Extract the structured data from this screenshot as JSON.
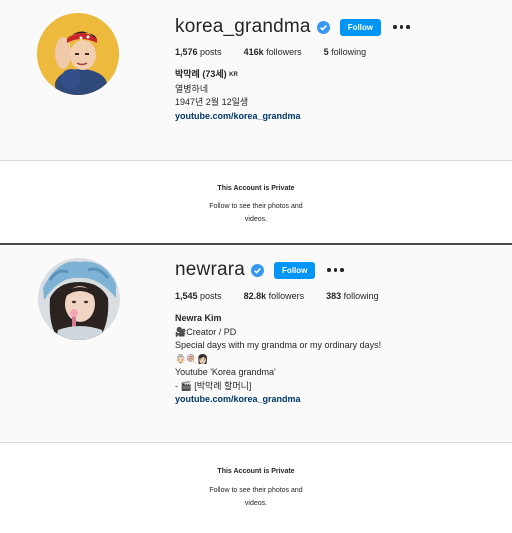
{
  "profiles": [
    {
      "username": "korea_grandma",
      "follow_label": "Follow",
      "posts_count": "1,576",
      "posts_label": "posts",
      "followers_count": "416k",
      "followers_label": "followers",
      "following_count": "5",
      "following_label": "following",
      "bio_name": "박막례 (73세)",
      "bio_name_suffix": "KR",
      "bio_lines": [
        "열병하네",
        "1947년 2월 12일생"
      ],
      "link": "youtube.com/korea_grandma"
    },
    {
      "username": "newrara",
      "follow_label": "Follow",
      "posts_count": "1,545",
      "posts_label": "posts",
      "followers_count": "82.8k",
      "followers_label": "followers",
      "following_count": "383",
      "following_label": "following",
      "bio_name": "Newra Kim",
      "bio_lines": [
        "🎥Creator / PD",
        "Special days with my grandma or my ordinary days!",
        "👵🏻🍭👩🏻",
        "Youtube 'Korea grandma'",
        "- 🎬 [박막례 할머니]"
      ],
      "link": "youtube.com/korea_grandma"
    }
  ],
  "private_notice": {
    "title": "This Account is Private",
    "sub_line1": "Follow to see their photos and",
    "sub_line2": "videos."
  },
  "colors": {
    "follow_button": "#0095f6",
    "verified_badge": "#3897f0",
    "link": "#00376b"
  },
  "icons": [
    "verified-badge-icon",
    "more-options-icon"
  ]
}
